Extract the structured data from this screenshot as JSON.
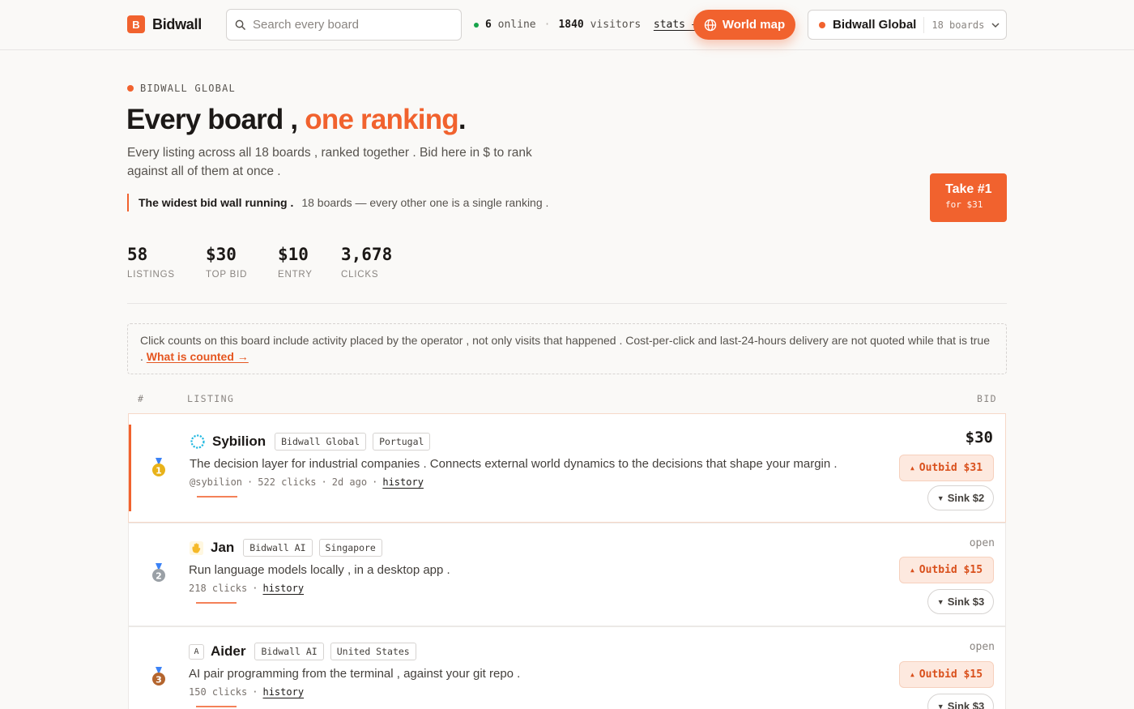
{
  "header": {
    "logo_letter": "B",
    "logo_text": "Bidwall",
    "search_placeholder": "Search every board",
    "online_count": "6",
    "online_label": "online",
    "visitors_count": "1840",
    "visitors_label": "visitors",
    "stats_link": "stats →",
    "world_map_label": "World map",
    "board_name": "Bidwall Global",
    "board_count": "18 boards"
  },
  "hero": {
    "eyebrow": "BIDWALL GLOBAL",
    "title_main": "Every board ,",
    "title_accent": "one ranking",
    "title_end": ".",
    "subtitle": "Every listing across all 18 boards , ranked together . Bid here in $ to rank against all of them at once .",
    "quote_strong": "The widest bid wall running .",
    "quote_rest": "18 boards — every other one is a single ranking .",
    "take_title": "Take #1",
    "take_sub": "for $31"
  },
  "stats": [
    {
      "value": "58",
      "label": "LISTINGS"
    },
    {
      "value": "$30",
      "label": "TOP BID"
    },
    {
      "value": "$10",
      "label": "ENTRY"
    },
    {
      "value": "3,678",
      "label": "CLICKS"
    }
  ],
  "notice": {
    "text": "Click counts on this board include activity placed by the operator , not only visits that happened . Cost-per-click and last-24-hours delivery are not quoted while that is true .",
    "link": "What is counted →"
  },
  "table": {
    "col_rank": "#",
    "col_listing": "LISTING",
    "col_bid": "BID"
  },
  "listings": [
    {
      "rank": 1,
      "name": "Sybilion",
      "board": "Bidwall Global",
      "country": "Portugal",
      "description": "The decision layer for industrial companies . Connects external world dynamics to the decisions that shape your margin .",
      "handle": "@sybilion",
      "clicks": "522 clicks",
      "age": "2d ago",
      "history": "history",
      "bid": "$30",
      "outbid": "Outbid $31",
      "sink": "Sink $2"
    },
    {
      "rank": 2,
      "name": "Jan",
      "board": "Bidwall AI",
      "country": "Singapore",
      "description": "Run language models locally , in a desktop app .",
      "clicks": "218 clicks",
      "history": "history",
      "bid": "open",
      "outbid": "Outbid $15",
      "sink": "Sink $3"
    },
    {
      "rank": 3,
      "avatar_letter": "A",
      "name": "Aider",
      "board": "Bidwall AI",
      "country": "United States",
      "description": "AI pair programming from the terminal , against your git repo .",
      "clicks": "150 clicks",
      "history": "history",
      "bid": "open",
      "outbid": "Outbid $15",
      "sink": "Sink $3"
    }
  ],
  "icons": {
    "outbid_arrow": "▲",
    "sink_arrow": "▼"
  },
  "colors": {
    "accent": "#f1622e",
    "online": "#16a34a",
    "gold": "#e8b21a",
    "silver": "#9aa0a6",
    "bronze": "#b4652e"
  }
}
